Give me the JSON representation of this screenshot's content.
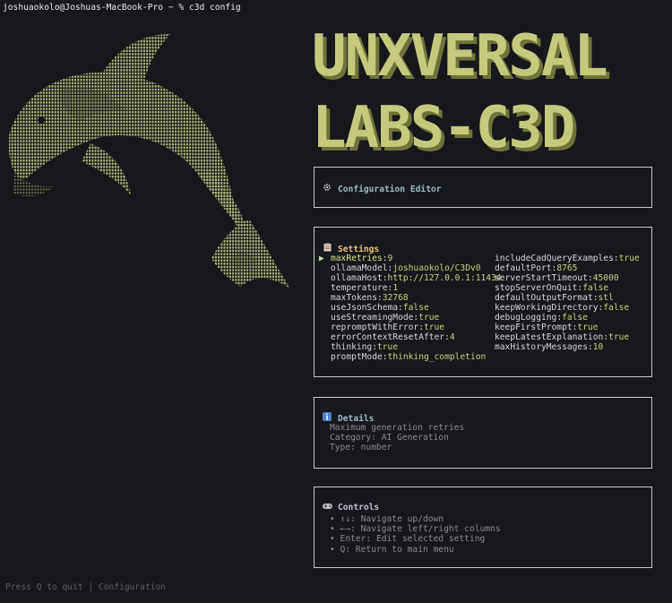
{
  "terminal": {
    "prompt": "joshuaokolo@Joshuas-MacBook-Pro ~ % c3d config"
  },
  "banner": {
    "line1": "UNXVERSAL",
    "line2": "LABS-C3D",
    "color": "#c4c97e",
    "shadow": "#6f7339"
  },
  "editor": {
    "icon": "gear-icon",
    "title": "Configuration Editor"
  },
  "settings": {
    "icon": "clipboard-icon",
    "title": "Settings",
    "left": [
      {
        "key": "maxRetries",
        "value": "9",
        "selected": true
      },
      {
        "key": "ollamaModel",
        "value": "joshuaokolo/C3Dv0"
      },
      {
        "key": "ollamaHost",
        "value": "http://127.0.0.1:11434"
      },
      {
        "key": "temperature",
        "value": "1"
      },
      {
        "key": "maxTokens",
        "value": "32768"
      },
      {
        "key": "useJsonSchema",
        "value": "false"
      },
      {
        "key": "useStreamingMode",
        "value": "true"
      },
      {
        "key": "repromptWithError",
        "value": "true"
      },
      {
        "key": "errorContextResetAfter",
        "value": "4"
      },
      {
        "key": "thinking",
        "value": "true"
      },
      {
        "key": "promptMode",
        "value": "thinking_completion"
      }
    ],
    "right": [
      {
        "key": "includeCadQueryExamples",
        "value": "true"
      },
      {
        "key": "defaultPort",
        "value": "8765"
      },
      {
        "key": "serverStartTimeout",
        "value": "45000"
      },
      {
        "key": "stopServerOnQuit",
        "value": "false"
      },
      {
        "key": "defaultOutputFormat",
        "value": "stl"
      },
      {
        "key": "keepWorkingDirectory",
        "value": "false"
      },
      {
        "key": "debugLogging",
        "value": "false"
      },
      {
        "key": "keepFirstPrompt",
        "value": "true"
      },
      {
        "key": "keepLatestExplanation",
        "value": "true"
      },
      {
        "key": "maxHistoryMessages",
        "value": "10"
      }
    ]
  },
  "details": {
    "icon": "info-icon",
    "title": "Details",
    "lines": [
      "Maximum generation retries",
      "Category: AI Generation",
      "Type: number"
    ]
  },
  "controls": {
    "icon": "gamepad-icon",
    "title": "Controls",
    "lines": [
      "• ↑↓: Navigate up/down",
      "• ←→: Navigate left/right columns",
      "• Enter: Edit selected setting",
      "• Q: Return to main menu"
    ]
  },
  "footer": "Press Q to quit | Configuration"
}
